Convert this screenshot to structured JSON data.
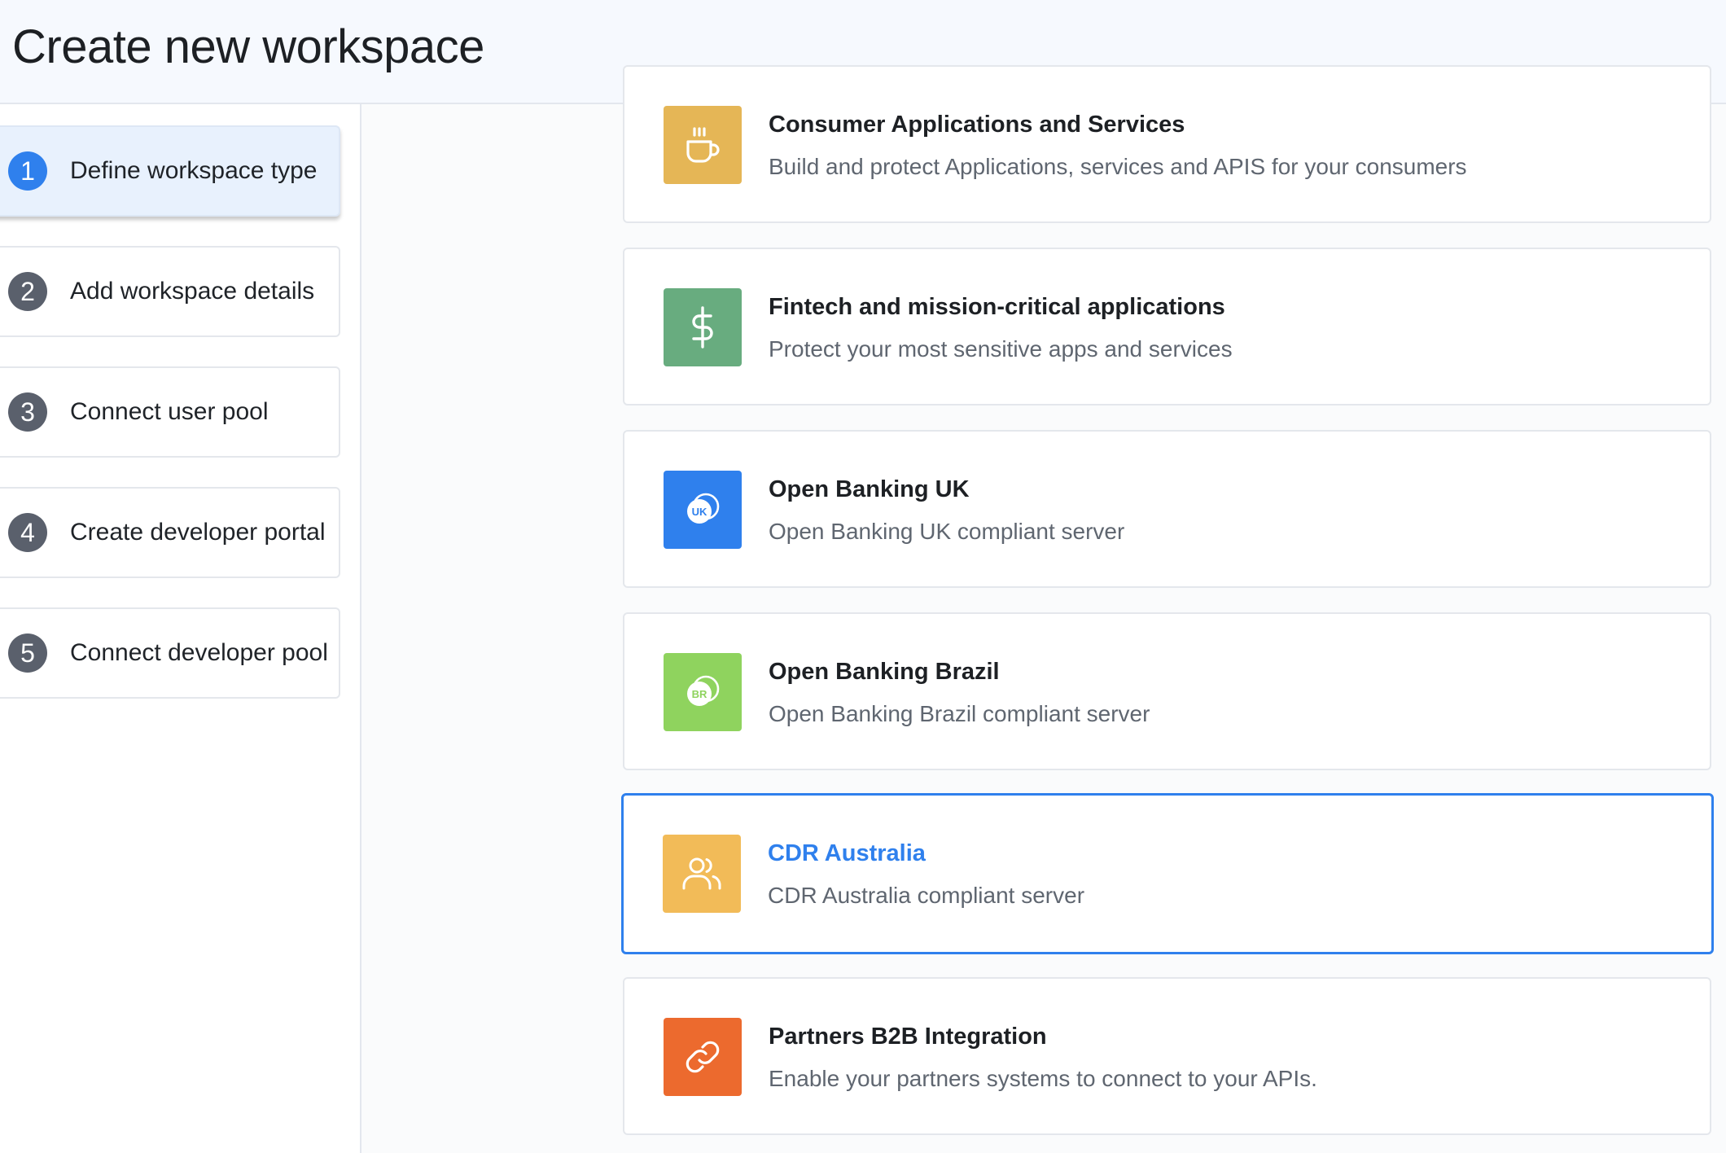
{
  "header": {
    "title": "Create new workspace"
  },
  "steps": [
    {
      "number": "1",
      "label": "Define workspace type",
      "active": true
    },
    {
      "number": "2",
      "label": "Add workspace details",
      "active": false
    },
    {
      "number": "3",
      "label": "Connect user pool",
      "active": false
    },
    {
      "number": "4",
      "label": "Create developer portal",
      "active": false
    },
    {
      "number": "5",
      "label": "Connect developer pool",
      "active": false
    }
  ],
  "cards": [
    {
      "title": "Consumer Applications and Services",
      "description": "Build and protect Applications, services and APIS for your consumers",
      "icon": "coffee-cup-icon",
      "color": "#e5b656",
      "selected": false
    },
    {
      "title": "Fintech and mission-critical applications",
      "description": "Protect your most sensitive apps and services",
      "icon": "dollar-icon",
      "color": "#68ac7f",
      "selected": false
    },
    {
      "title": "Open Banking UK",
      "description": "Open Banking UK compliant server",
      "icon": "uk-badge-icon",
      "icon_text": "UK",
      "color": "#2f80ed",
      "selected": false
    },
    {
      "title": "Open Banking Brazil",
      "description": "Open Banking Brazil compliant server",
      "icon": "br-badge-icon",
      "icon_text": "BR",
      "color": "#8fd35e",
      "selected": false
    },
    {
      "title": "CDR Australia",
      "description": "CDR Australia compliant server",
      "icon": "users-icon",
      "color": "#f2bb58",
      "selected": true
    },
    {
      "title": "Partners B2B Integration",
      "description": "Enable your partners systems to connect to your APIs.",
      "icon": "link-icon",
      "color": "#ec6a2e",
      "selected": false
    }
  ],
  "colors": {
    "accent": "#2f80ed",
    "step_inactive": "#5a606c"
  }
}
